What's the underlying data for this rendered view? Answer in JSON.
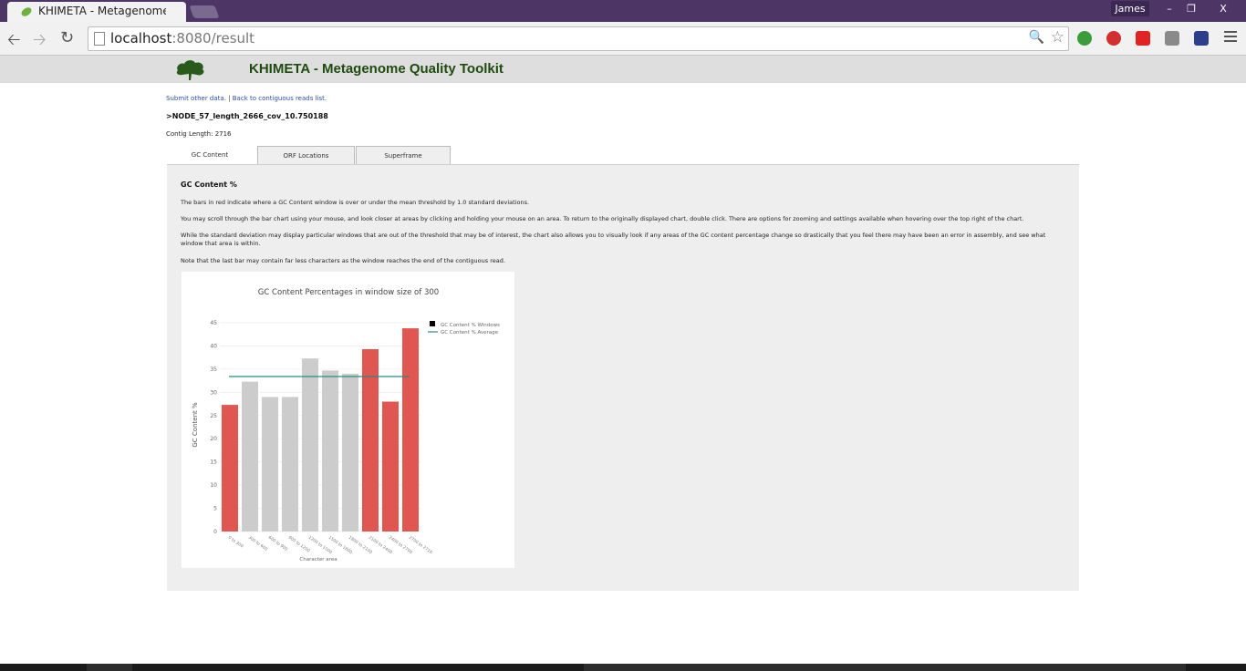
{
  "browser": {
    "tab_title": "KHIMETA - Metagenome",
    "url_host": "localhost",
    "url_rest": ":8080/result",
    "user": "James",
    "icons": [
      "back-icon",
      "forward-icon",
      "reload-icon",
      "page-icon",
      "zoom-icon",
      "star-icon",
      "menu-icon"
    ],
    "controls": {
      "minimize": "–",
      "restore": "❐",
      "close": "X"
    }
  },
  "header": {
    "title": "KHIMETA - Metagenome Quality Toolkit"
  },
  "links": {
    "submit": "Submit other data.",
    "separator": " | ",
    "back": "Back to contiguous reads list."
  },
  "read": {
    "name": ">NODE_57_length_2666_cov_10.750188",
    "contig_length": "Contig Length: 2716"
  },
  "tabs": [
    {
      "label": "GC Content",
      "active": true
    },
    {
      "label": "ORF Locations",
      "active": false
    },
    {
      "label": "Superframe",
      "active": false
    }
  ],
  "panel": {
    "heading": "GC Content %",
    "para1": "The bars in red indicate where a GC Content window is over or under the mean threshold by 1.0 standard deviations.",
    "para2": "You may scroll through the bar chart using your mouse, and look closer at areas by clicking and holding your mouse on an area. To return to the originally displayed chart, double click. There are options for zooming and settings available when hovering over the top right of the chart.",
    "para3": "While the standard deviation may display particular windows that are out of the threshold that may be of interest, the chart also allows you to visually look if any areas of the GC content percentage change so drastically that you feel there may have been an error in assembly, and see what window that area is within.",
    "para4": "Note that the last bar may contain far less characters as the window reaches the end of the contiguous read."
  },
  "colors": {
    "outlier": "#e05651",
    "normal": "#cccccc",
    "average": "#2a8a80",
    "header_text": "#1f4a10"
  },
  "chart_data": {
    "type": "bar",
    "title": "GC Content Percentages in window size of 300",
    "xlabel": "Character area",
    "ylabel": "GC Content %",
    "categories": [
      "0 to 300",
      "300 to 600",
      "600 to 900",
      "900 to 1200",
      "1200 to 1500",
      "1500 to 1800",
      "1800 to 2100",
      "2100 to 2400",
      "2400 to 2700",
      "2700 to 2716"
    ],
    "series": [
      {
        "name": "GC Content % Windows",
        "values": [
          27.3,
          32.3,
          29.0,
          29.0,
          37.3,
          34.7,
          34.0,
          39.3,
          28.0,
          43.8
        ]
      },
      {
        "name": "GC Content % Average",
        "values": [
          33.4,
          33.4,
          33.4,
          33.4,
          33.4,
          33.4,
          33.4,
          33.4,
          33.4,
          33.4
        ]
      }
    ],
    "outliers": [
      true,
      false,
      false,
      false,
      false,
      false,
      false,
      true,
      true,
      true
    ],
    "yticks": [
      0,
      5,
      10,
      15,
      20,
      25,
      30,
      35,
      40,
      45
    ],
    "ylim": [
      0,
      45
    ],
    "legend": "top-right",
    "grid": true
  }
}
